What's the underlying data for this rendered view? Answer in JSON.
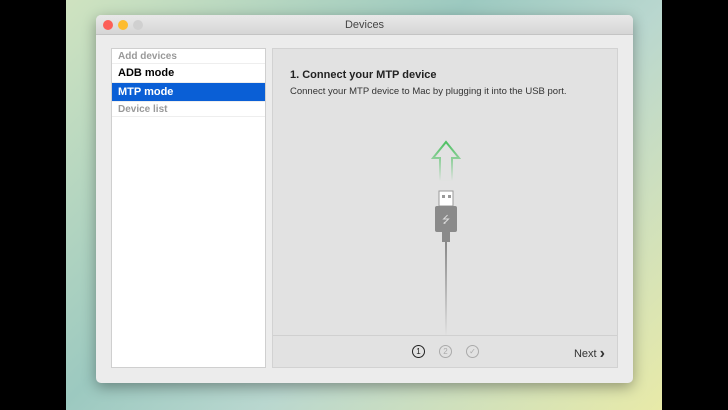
{
  "window": {
    "title": "Devices"
  },
  "sidebar": {
    "header_add": "Add devices",
    "items": [
      {
        "label": "ADB mode"
      },
      {
        "label": "MTP mode"
      }
    ],
    "header_list": "Device list"
  },
  "main": {
    "title": "1. Connect your MTP device",
    "description": "Connect your MTP device to Mac by plugging it into the USB port.",
    "steps": [
      "1",
      "2",
      "✓"
    ],
    "next_label": "Next",
    "next_icon": "›"
  },
  "colors": {
    "accent": "#0a5fd6",
    "arrow": "#4cc061"
  }
}
